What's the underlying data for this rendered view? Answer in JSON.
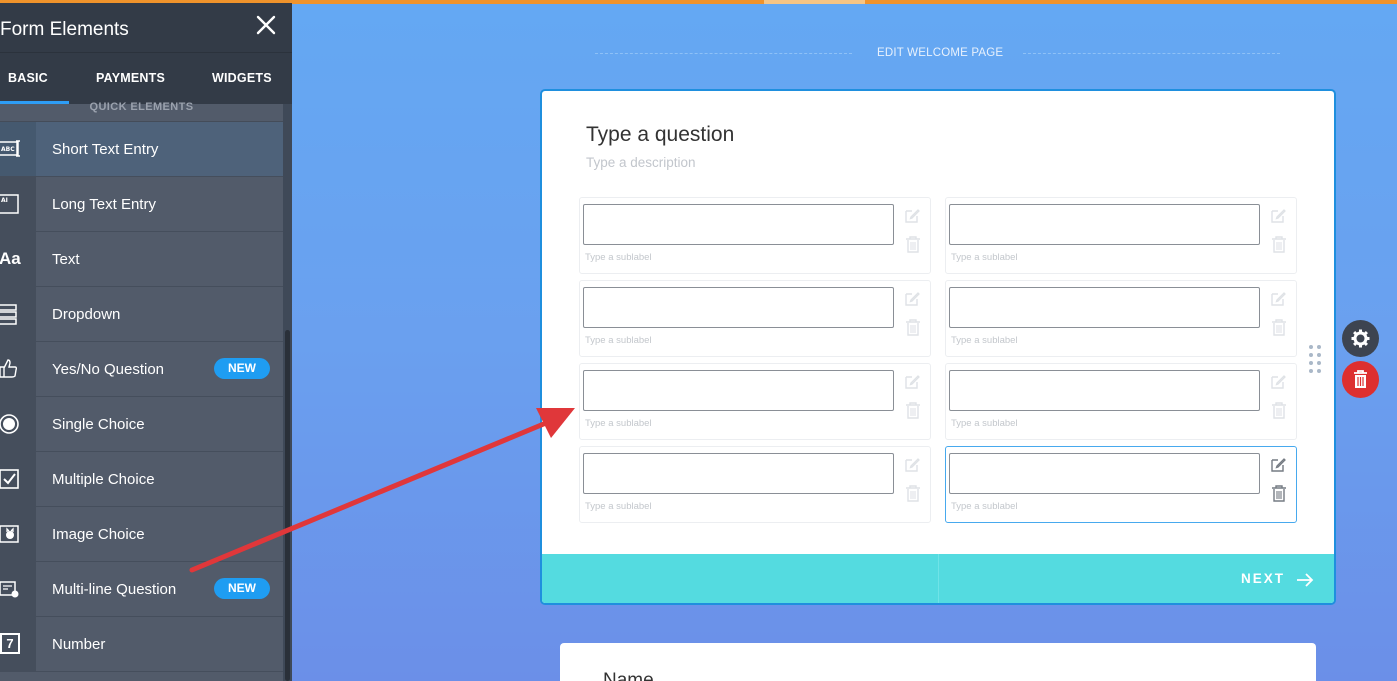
{
  "sidebar": {
    "title": "Form Elements",
    "tabs": [
      "BASIC",
      "PAYMENTS",
      "WIDGETS"
    ],
    "active_tab": "BASIC",
    "section_label": "QUICK ELEMENTS",
    "items": [
      {
        "label": "Short Text Entry",
        "icon": "short-text-icon"
      },
      {
        "label": "Long Text Entry",
        "icon": "long-text-icon"
      },
      {
        "label": "Text",
        "icon": "text-aa-icon",
        "glyph": "Aa"
      },
      {
        "label": "Dropdown",
        "icon": "dropdown-icon"
      },
      {
        "label": "Yes/No Question",
        "icon": "thumbs-icon",
        "badge": "NEW"
      },
      {
        "label": "Single Choice",
        "icon": "radio-icon"
      },
      {
        "label": "Multiple Choice",
        "icon": "checkbox-icon"
      },
      {
        "label": "Image Choice",
        "icon": "image-icon"
      },
      {
        "label": "Multi-line Question",
        "icon": "multiline-icon",
        "badge": "NEW"
      },
      {
        "label": "Number",
        "icon": "number-icon",
        "glyph": "7"
      }
    ]
  },
  "main": {
    "welcome_link": "EDIT WELCOME PAGE",
    "question": {
      "title": "Type a question",
      "description": "Type a description",
      "sublabel": "Type a sublabel",
      "fields": [
        {
          "sublabel": "Type a sublabel"
        },
        {
          "sublabel": "Type a sublabel"
        },
        {
          "sublabel": "Type a sublabel"
        },
        {
          "sublabel": "Type a sublabel"
        },
        {
          "sublabel": "Type a sublabel"
        },
        {
          "sublabel": "Type a sublabel"
        },
        {
          "sublabel": "Type a sublabel"
        },
        {
          "sublabel": "Type a sublabel"
        }
      ],
      "next_label": "NEXT"
    },
    "next_card_title": "Name"
  },
  "colors": {
    "accent": "#1f9df2",
    "footer": "#54dbe0",
    "delete": "#dd2f2f",
    "annotation_arrow": "#e0373a"
  }
}
